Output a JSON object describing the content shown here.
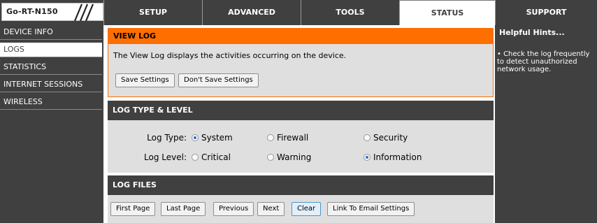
{
  "logo": {
    "text": "Go-RT-N150"
  },
  "nav": {
    "setup": "SETUP",
    "advanced": "ADVANCED",
    "tools": "TOOLS",
    "status": "STATUS",
    "support": "SUPPORT"
  },
  "sidebar": {
    "items": [
      {
        "label": "DEVICE INFO"
      },
      {
        "label": "LOGS"
      },
      {
        "label": "STATISTICS"
      },
      {
        "label": "INTERNET SESSIONS"
      },
      {
        "label": "WIRELESS"
      }
    ]
  },
  "view_log": {
    "title": "VIEW LOG",
    "description": "The View Log displays the activities occurring on the device.",
    "save_label": "Save Settings",
    "dont_save_label": "Don't Save Settings"
  },
  "log_type_level": {
    "title": "LOG TYPE & LEVEL",
    "type_label": "Log Type:",
    "level_label": "Log Level:",
    "type_options": [
      {
        "label": "System",
        "selected": true
      },
      {
        "label": "Firewall",
        "selected": false
      },
      {
        "label": "Security",
        "selected": false
      }
    ],
    "level_options": [
      {
        "label": "Critical",
        "selected": false
      },
      {
        "label": "Warning",
        "selected": false
      },
      {
        "label": "Information",
        "selected": true
      }
    ]
  },
  "log_files": {
    "title": "LOG FILES",
    "buttons": {
      "first_page": "First Page",
      "last_page": "Last Page",
      "previous": "Previous",
      "next": "Next",
      "clear": "Clear",
      "email": "Link To Email Settings"
    }
  },
  "help": {
    "title": "Helpful Hints...",
    "text": "• Check the log frequently to detect unauthorized network usage."
  },
  "colors": {
    "dark": "#404040",
    "accent": "#ff6f00",
    "panel": "#dfdfdf"
  }
}
